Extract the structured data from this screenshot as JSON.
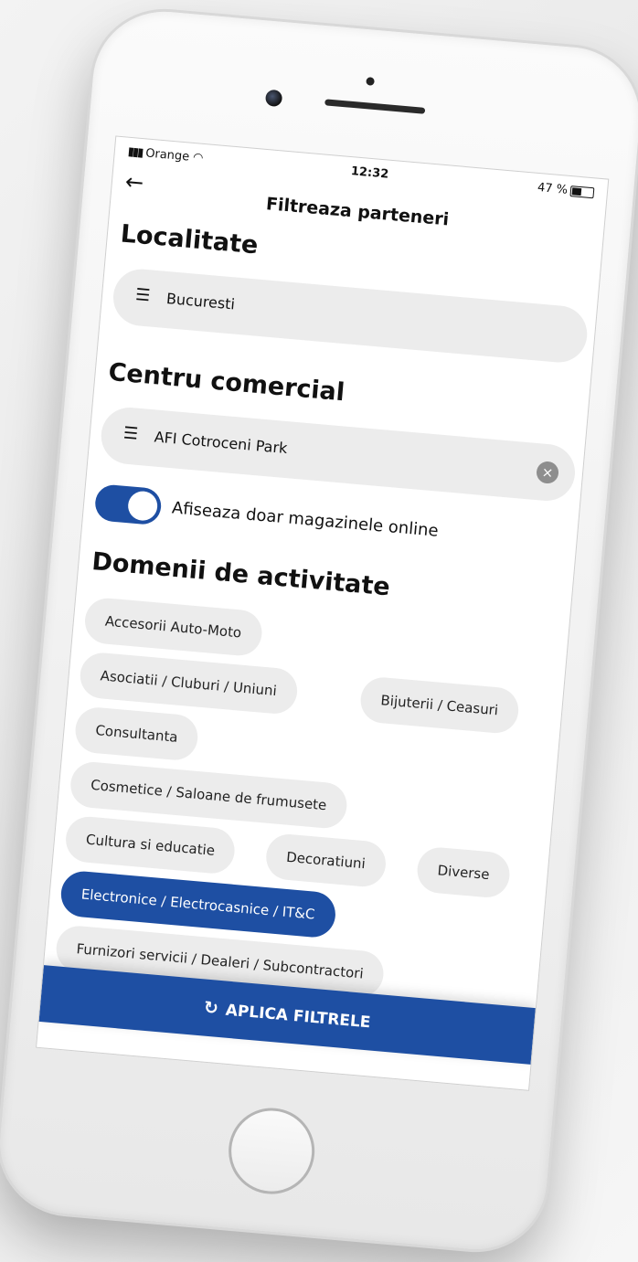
{
  "status_bar": {
    "signal_icon": "signal-bars-icon",
    "carrier": "Orange",
    "wifi_icon": "wifi-icon",
    "time": "12:32",
    "battery_text": "47 %",
    "battery_icon": "battery-icon",
    "battery_level": 0.47
  },
  "header": {
    "back_icon": "back-arrow-icon",
    "title": "Filtreaza parteneri"
  },
  "locality": {
    "section_title": "Localitate",
    "list_icon": "list-icon",
    "value": "Bucuresti"
  },
  "mall": {
    "section_title": "Centru comercial",
    "list_icon": "list-icon",
    "value": "AFI Cotroceni Park",
    "clear_icon": "clear-icon"
  },
  "online_toggle": {
    "label": "Afiseaza doar magazinele online",
    "enabled": true
  },
  "domains": {
    "section_title": "Domenii de activitate",
    "chips": [
      {
        "label": "Accesorii Auto-Moto",
        "selected": false
      },
      {
        "label": "Asociatii / Cluburi / Uniuni",
        "selected": false
      },
      {
        "label": "Bijuterii / Ceasuri",
        "selected": false
      },
      {
        "label": "Consultanta",
        "selected": false
      },
      {
        "label": "Cosmetice / Saloane de frumusete",
        "selected": false
      },
      {
        "label": "Cultura si educatie",
        "selected": false
      },
      {
        "label": "Decoratiuni",
        "selected": false
      },
      {
        "label": "Diverse",
        "selected": false
      },
      {
        "label": "Electronice / Electrocasnice / IT&C",
        "selected": true
      },
      {
        "label": "Furnizori servicii / Dealeri / Subcontractori",
        "selected": false
      }
    ]
  },
  "apply_button": {
    "icon": "refresh-icon",
    "label": "APLICA FILTRELE"
  },
  "colors": {
    "accent": "#1e4fa3",
    "chip_bg": "#ececec",
    "text": "#111111"
  }
}
